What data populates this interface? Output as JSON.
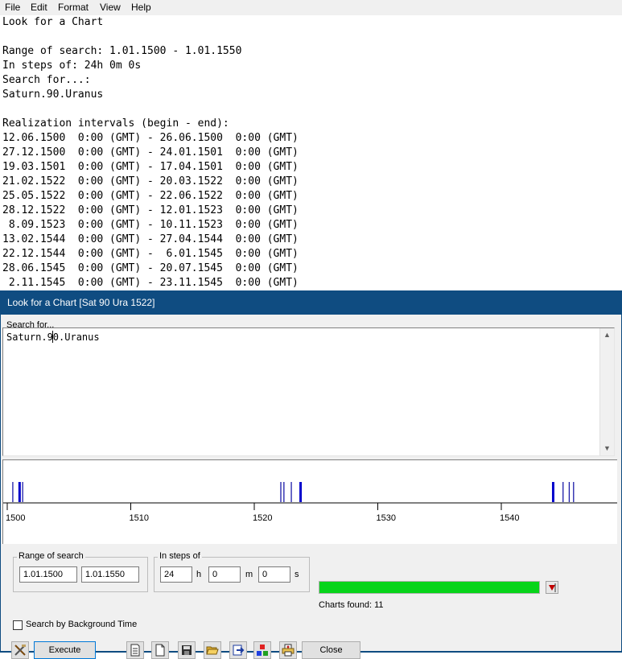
{
  "menu": [
    "File",
    "Edit",
    "Format",
    "View",
    "Help"
  ],
  "report": {
    "title": "Look for a Chart",
    "range_line": "Range of search: 1.01.1500 - 1.01.1550",
    "steps_line": "In steps of: 24h 0m 0s",
    "search_for_line": "Search for...:",
    "search_expr": "Saturn.90.Uranus",
    "intervals_header": "Realization intervals (begin - end):",
    "intervals": [
      "12.06.1500  0:00 (GMT) - 26.06.1500  0:00 (GMT)",
      "27.12.1500  0:00 (GMT) - 24.01.1501  0:00 (GMT)",
      "19.03.1501  0:00 (GMT) - 17.04.1501  0:00 (GMT)",
      "21.02.1522  0:00 (GMT) - 20.03.1522  0:00 (GMT)",
      "25.05.1522  0:00 (GMT) - 22.06.1522  0:00 (GMT)",
      "28.12.1522  0:00 (GMT) - 12.01.1523  0:00 (GMT)",
      " 8.09.1523  0:00 (GMT) - 10.11.1523  0:00 (GMT)",
      "13.02.1544  0:00 (GMT) - 27.04.1544  0:00 (GMT)",
      "22.12.1544  0:00 (GMT) -  6.01.1545  0:00 (GMT)",
      "28.06.1545  0:00 (GMT) - 20.07.1545  0:00 (GMT)",
      " 2.11.1545  0:00 (GMT) - 23.11.1545  0:00 (GMT)"
    ]
  },
  "dialog": {
    "title": "Look for a Chart [Sat 90 Ura 1522]",
    "search_group_label": "Search for...",
    "search_text": "Saturn.90.Uranus",
    "timeline": {
      "year_start": 1500,
      "year_end": 1549,
      "tick_labels": [
        "1500",
        "1510",
        "1520",
        "1530",
        "1540"
      ],
      "markers": [
        {
          "year": 1500.45,
          "bold": false
        },
        {
          "year": 1501.0,
          "bold": true
        },
        {
          "year": 1501.25,
          "bold": false
        },
        {
          "year": 1522.15,
          "bold": false
        },
        {
          "year": 1522.4,
          "bold": false
        },
        {
          "year": 1523.0,
          "bold": false
        },
        {
          "year": 1523.75,
          "bold": true
        },
        {
          "year": 1544.2,
          "bold": true
        },
        {
          "year": 1545.0,
          "bold": false
        },
        {
          "year": 1545.5,
          "bold": false
        },
        {
          "year": 1545.85,
          "bold": false
        }
      ]
    },
    "range": {
      "label": "Range of search",
      "from": "1.01.1500",
      "to": "1.01.1550"
    },
    "steps": {
      "label": "In steps of",
      "hours": "24",
      "h": "h",
      "minutes": "0",
      "m": "m",
      "seconds": "0",
      "s": "s"
    },
    "background_time_label": "Search by Background Time",
    "background_time_checked": false,
    "progress": 1.0,
    "progress_color": "#06d41a",
    "charts_found": "Charts found: 11",
    "buttons": {
      "execute": "Execute",
      "close": "Close"
    },
    "toolbar_icons": [
      "tools-icon",
      "report-icon",
      "new-document-icon",
      "save-icon",
      "open-folder-icon",
      "export-icon",
      "color-icon",
      "print-icon"
    ],
    "colors": {
      "title_bar": "#0f4c81",
      "marker": "#1a1aa8",
      "bold_marker": "#0000cc"
    }
  }
}
